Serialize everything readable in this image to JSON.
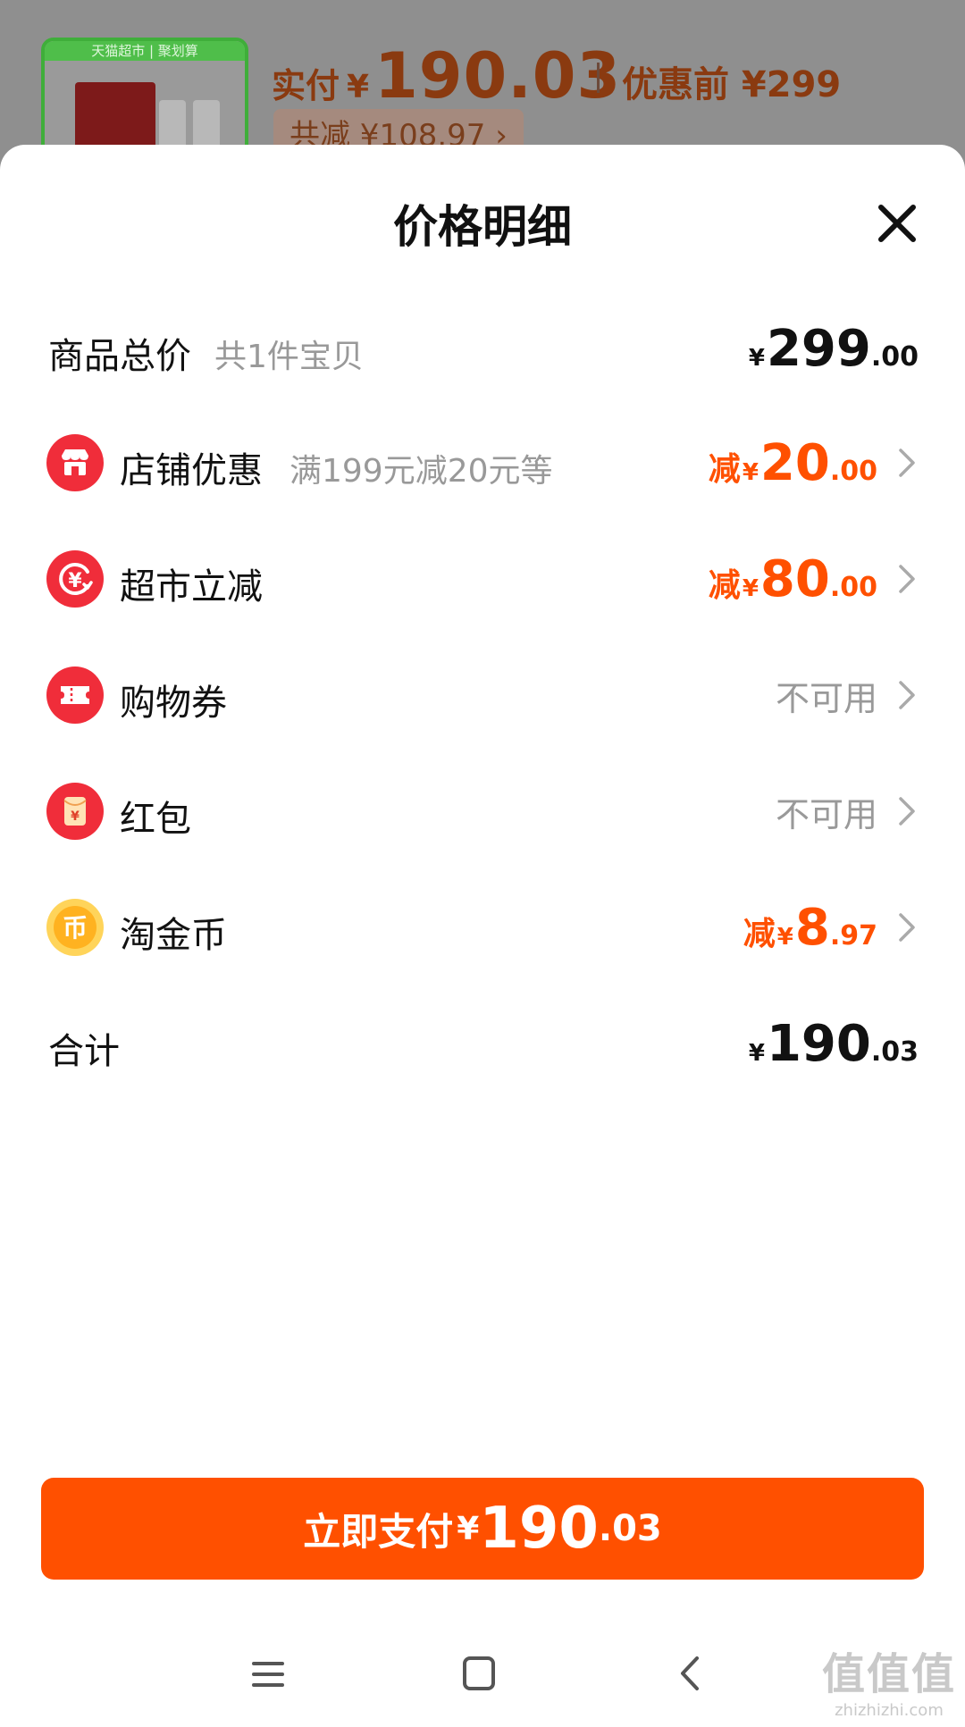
{
  "background": {
    "thumb_tag": "天猫超市 | 聚划算",
    "paid_label": "实付",
    "currency": "¥",
    "paid_amount": "190.03",
    "before_discount": "优惠前 ¥299",
    "total_saving": "共减 ¥108.97 ›"
  },
  "sheet": {
    "title": "价格明细",
    "close_icon": "close-icon"
  },
  "rows": {
    "goods_total": {
      "label": "商品总价",
      "sub": "共1件宝贝",
      "yen": "¥",
      "int": "299",
      "dec": ".00"
    },
    "store_discount": {
      "icon": "store-icon",
      "label": "店铺优惠",
      "sub": "满199元减20元等",
      "pre": "减",
      "yen": "¥",
      "int": "20",
      "dec": ".00"
    },
    "market_discount": {
      "icon": "yen-cycle-icon",
      "label": "超市立减",
      "pre": "减",
      "yen": "¥",
      "int": "80",
      "dec": ".00"
    },
    "shopping_voucher": {
      "icon": "voucher-icon",
      "label": "购物券",
      "status": "不可用"
    },
    "red_packet": {
      "icon": "red-packet-icon",
      "label": "红包",
      "status": "不可用"
    },
    "taojin_coins": {
      "icon": "coin-icon",
      "label": "淘金币",
      "pre": "减",
      "yen": "¥",
      "int": "8",
      "dec": ".97"
    },
    "subtotal": {
      "label": "合计",
      "yen": "¥",
      "int": "190",
      "dec": ".03"
    }
  },
  "pay_button": {
    "label": "立即支付",
    "yen": "¥",
    "int": "190",
    "dec": ".03"
  },
  "nav": {
    "menu_icon": "menu-icon",
    "home_icon": "home-icon",
    "back_icon": "back-icon"
  },
  "watermark": {
    "big": "值值值",
    "small": "zhizhizhi.com"
  },
  "colors": {
    "accent": "#ff5000",
    "icon_red": "#f02d3a",
    "coin_gold": "#ffb220",
    "muted_text": "#999999"
  }
}
